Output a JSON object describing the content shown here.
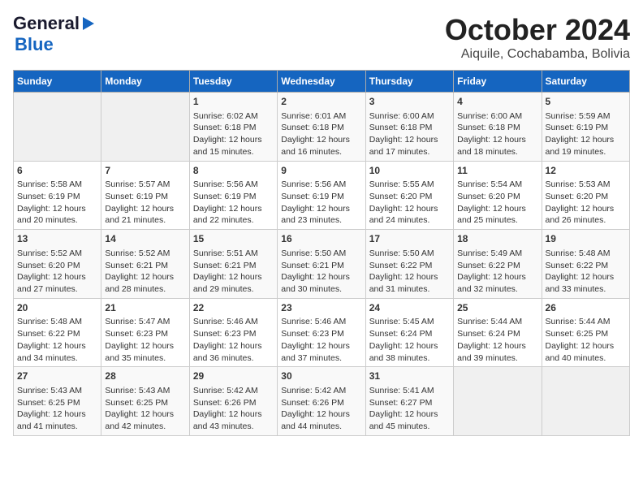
{
  "header": {
    "logo_line1": "General",
    "logo_line2": "Blue",
    "title": "October 2024",
    "subtitle": "Aiquile, Cochabamba, Bolivia"
  },
  "days_of_week": [
    "Sunday",
    "Monday",
    "Tuesday",
    "Wednesday",
    "Thursday",
    "Friday",
    "Saturday"
  ],
  "weeks": [
    [
      {
        "day": "",
        "empty": true
      },
      {
        "day": "",
        "empty": true
      },
      {
        "day": "1",
        "sunrise": "Sunrise: 6:02 AM",
        "sunset": "Sunset: 6:18 PM",
        "daylight": "Daylight: 12 hours and 15 minutes."
      },
      {
        "day": "2",
        "sunrise": "Sunrise: 6:01 AM",
        "sunset": "Sunset: 6:18 PM",
        "daylight": "Daylight: 12 hours and 16 minutes."
      },
      {
        "day": "3",
        "sunrise": "Sunrise: 6:00 AM",
        "sunset": "Sunset: 6:18 PM",
        "daylight": "Daylight: 12 hours and 17 minutes."
      },
      {
        "day": "4",
        "sunrise": "Sunrise: 6:00 AM",
        "sunset": "Sunset: 6:18 PM",
        "daylight": "Daylight: 12 hours and 18 minutes."
      },
      {
        "day": "5",
        "sunrise": "Sunrise: 5:59 AM",
        "sunset": "Sunset: 6:19 PM",
        "daylight": "Daylight: 12 hours and 19 minutes."
      }
    ],
    [
      {
        "day": "6",
        "sunrise": "Sunrise: 5:58 AM",
        "sunset": "Sunset: 6:19 PM",
        "daylight": "Daylight: 12 hours and 20 minutes."
      },
      {
        "day": "7",
        "sunrise": "Sunrise: 5:57 AM",
        "sunset": "Sunset: 6:19 PM",
        "daylight": "Daylight: 12 hours and 21 minutes."
      },
      {
        "day": "8",
        "sunrise": "Sunrise: 5:56 AM",
        "sunset": "Sunset: 6:19 PM",
        "daylight": "Daylight: 12 hours and 22 minutes."
      },
      {
        "day": "9",
        "sunrise": "Sunrise: 5:56 AM",
        "sunset": "Sunset: 6:19 PM",
        "daylight": "Daylight: 12 hours and 23 minutes."
      },
      {
        "day": "10",
        "sunrise": "Sunrise: 5:55 AM",
        "sunset": "Sunset: 6:20 PM",
        "daylight": "Daylight: 12 hours and 24 minutes."
      },
      {
        "day": "11",
        "sunrise": "Sunrise: 5:54 AM",
        "sunset": "Sunset: 6:20 PM",
        "daylight": "Daylight: 12 hours and 25 minutes."
      },
      {
        "day": "12",
        "sunrise": "Sunrise: 5:53 AM",
        "sunset": "Sunset: 6:20 PM",
        "daylight": "Daylight: 12 hours and 26 minutes."
      }
    ],
    [
      {
        "day": "13",
        "sunrise": "Sunrise: 5:52 AM",
        "sunset": "Sunset: 6:20 PM",
        "daylight": "Daylight: 12 hours and 27 minutes."
      },
      {
        "day": "14",
        "sunrise": "Sunrise: 5:52 AM",
        "sunset": "Sunset: 6:21 PM",
        "daylight": "Daylight: 12 hours and 28 minutes."
      },
      {
        "day": "15",
        "sunrise": "Sunrise: 5:51 AM",
        "sunset": "Sunset: 6:21 PM",
        "daylight": "Daylight: 12 hours and 29 minutes."
      },
      {
        "day": "16",
        "sunrise": "Sunrise: 5:50 AM",
        "sunset": "Sunset: 6:21 PM",
        "daylight": "Daylight: 12 hours and 30 minutes."
      },
      {
        "day": "17",
        "sunrise": "Sunrise: 5:50 AM",
        "sunset": "Sunset: 6:22 PM",
        "daylight": "Daylight: 12 hours and 31 minutes."
      },
      {
        "day": "18",
        "sunrise": "Sunrise: 5:49 AM",
        "sunset": "Sunset: 6:22 PM",
        "daylight": "Daylight: 12 hours and 32 minutes."
      },
      {
        "day": "19",
        "sunrise": "Sunrise: 5:48 AM",
        "sunset": "Sunset: 6:22 PM",
        "daylight": "Daylight: 12 hours and 33 minutes."
      }
    ],
    [
      {
        "day": "20",
        "sunrise": "Sunrise: 5:48 AM",
        "sunset": "Sunset: 6:22 PM",
        "daylight": "Daylight: 12 hours and 34 minutes."
      },
      {
        "day": "21",
        "sunrise": "Sunrise: 5:47 AM",
        "sunset": "Sunset: 6:23 PM",
        "daylight": "Daylight: 12 hours and 35 minutes."
      },
      {
        "day": "22",
        "sunrise": "Sunrise: 5:46 AM",
        "sunset": "Sunset: 6:23 PM",
        "daylight": "Daylight: 12 hours and 36 minutes."
      },
      {
        "day": "23",
        "sunrise": "Sunrise: 5:46 AM",
        "sunset": "Sunset: 6:23 PM",
        "daylight": "Daylight: 12 hours and 37 minutes."
      },
      {
        "day": "24",
        "sunrise": "Sunrise: 5:45 AM",
        "sunset": "Sunset: 6:24 PM",
        "daylight": "Daylight: 12 hours and 38 minutes."
      },
      {
        "day": "25",
        "sunrise": "Sunrise: 5:44 AM",
        "sunset": "Sunset: 6:24 PM",
        "daylight": "Daylight: 12 hours and 39 minutes."
      },
      {
        "day": "26",
        "sunrise": "Sunrise: 5:44 AM",
        "sunset": "Sunset: 6:25 PM",
        "daylight": "Daylight: 12 hours and 40 minutes."
      }
    ],
    [
      {
        "day": "27",
        "sunrise": "Sunrise: 5:43 AM",
        "sunset": "Sunset: 6:25 PM",
        "daylight": "Daylight: 12 hours and 41 minutes."
      },
      {
        "day": "28",
        "sunrise": "Sunrise: 5:43 AM",
        "sunset": "Sunset: 6:25 PM",
        "daylight": "Daylight: 12 hours and 42 minutes."
      },
      {
        "day": "29",
        "sunrise": "Sunrise: 5:42 AM",
        "sunset": "Sunset: 6:26 PM",
        "daylight": "Daylight: 12 hours and 43 minutes."
      },
      {
        "day": "30",
        "sunrise": "Sunrise: 5:42 AM",
        "sunset": "Sunset: 6:26 PM",
        "daylight": "Daylight: 12 hours and 44 minutes."
      },
      {
        "day": "31",
        "sunrise": "Sunrise: 5:41 AM",
        "sunset": "Sunset: 6:27 PM",
        "daylight": "Daylight: 12 hours and 45 minutes."
      },
      {
        "day": "",
        "empty": true
      },
      {
        "day": "",
        "empty": true
      }
    ]
  ]
}
